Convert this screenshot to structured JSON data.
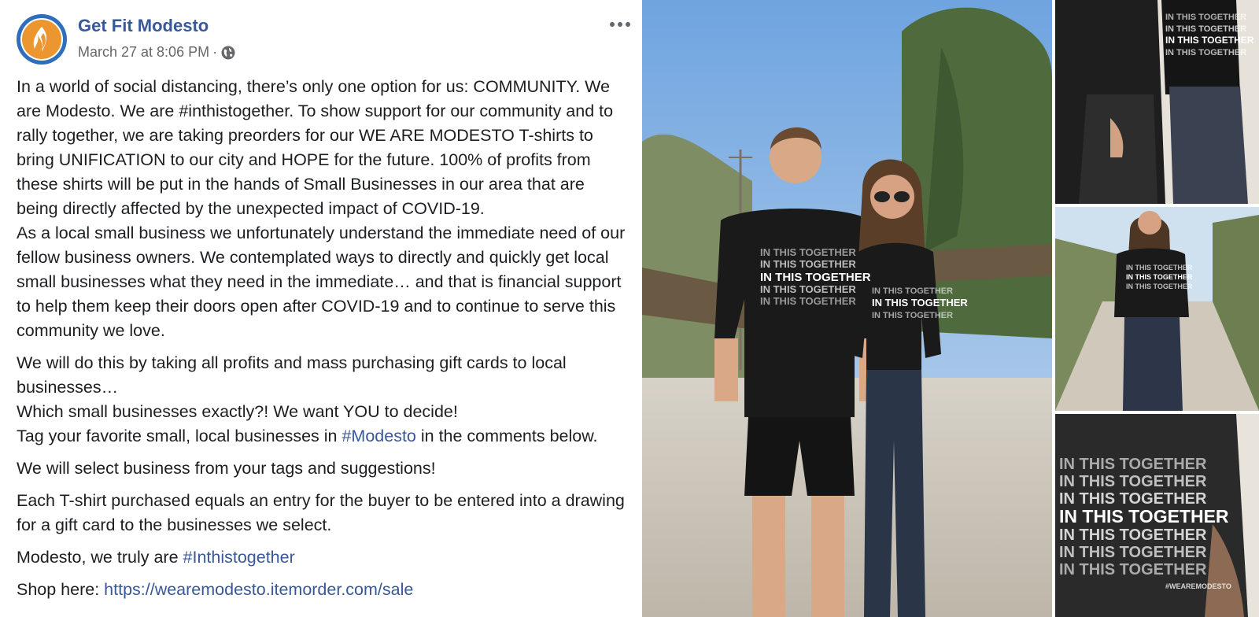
{
  "page": {
    "name": "Get Fit Modesto",
    "timestamp": "March 27 at 8:06 PM",
    "separator": "·",
    "audience_icon": "globe-icon",
    "more_icon": "more-options-icon"
  },
  "post": {
    "p1": "In a world of social distancing, there’s only one option for us: COMMUNITY. We are Modesto. We are #inthistogether. To show support for our community and to rally together, we are taking preorders for our WE ARE MODESTO T-shirts to bring UNIFICATION to our city and HOPE for the future. 100% of profits from these shirts will be put in the hands of Small Businesses in our area that are being directly affected by the unexpected impact of COVID-19.",
    "p1b": "As a local small business we unfortunately understand the immediate need of our fellow business owners. We contemplated ways to directly and quickly get local small businesses what they need in the immediate… and that is financial support to help them keep their doors open after COVID-19 and to continue to serve this community we love.",
    "p2": "We will do this by taking all profits and mass purchasing gift cards to local businesses…",
    "p2b": "Which small businesses exactly?! We want YOU to decide!",
    "p2c_before": "Tag your favorite small, local businesses in ",
    "p2c_hashtag": "#Modesto",
    "p2c_after": " in the comments below.",
    "p3": "We will select business from your tags and suggestions!",
    "p4": "Each T-shirt purchased equals an entry for the buyer to be entered into a drawing for a gift card to the businesses we select.",
    "p5_before": "Modesto, we truly are ",
    "p5_hashtag": "#Inthistogether",
    "p6_before": "Shop here: ",
    "p6_link": "https://wearemodesto.itemorder.com/sale"
  },
  "shirt": {
    "line": "IN THIS TOGETHER",
    "tag": "#WEAREMODESTO"
  },
  "colors": {
    "link": "#385898",
    "text": "#1c1e21",
    "meta": "#65676b",
    "avatar_ring": "#2f6eba",
    "avatar_fill": "#ec9630"
  }
}
